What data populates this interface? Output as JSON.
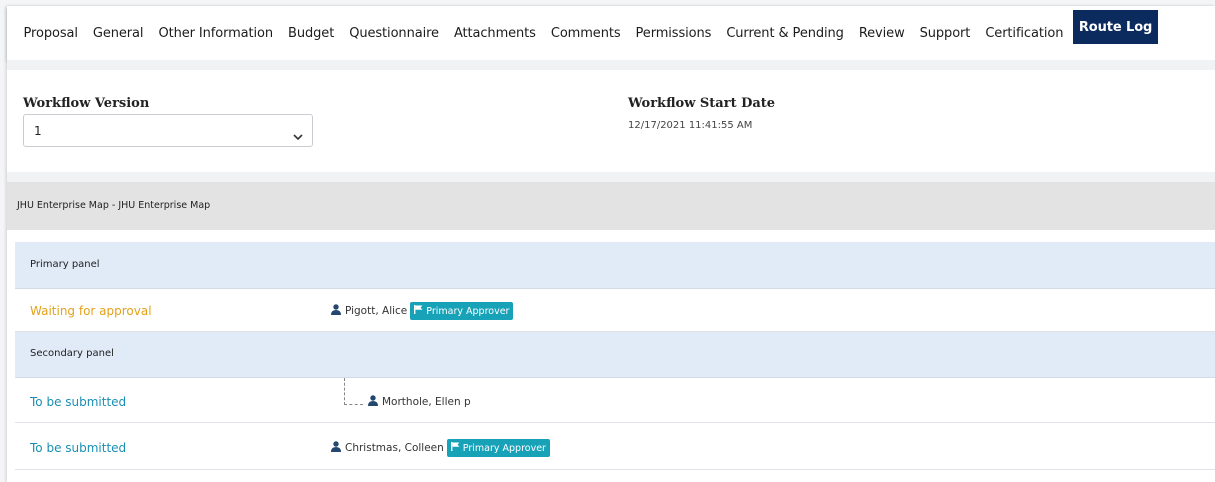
{
  "tabs": [
    {
      "label": "Proposal",
      "active": false
    },
    {
      "label": "General",
      "active": false
    },
    {
      "label": "Other Information",
      "active": false
    },
    {
      "label": "Budget",
      "active": false
    },
    {
      "label": "Questionnaire",
      "active": false
    },
    {
      "label": "Attachments",
      "active": false
    },
    {
      "label": "Comments",
      "active": false
    },
    {
      "label": "Permissions",
      "active": false
    },
    {
      "label": "Current & Pending",
      "active": false
    },
    {
      "label": "Review",
      "active": false
    },
    {
      "label": "Support",
      "active": false
    },
    {
      "label": "Certification",
      "active": false
    },
    {
      "label": "Route Log",
      "active": true
    }
  ],
  "workflow": {
    "version_label": "Workflow Version",
    "version_value": "1",
    "start_date_label": "Workflow Start Date",
    "start_date_value": "12/17/2021 11:41:55 AM"
  },
  "map_header": "JHU Enterprise Map - JHU Enterprise Map",
  "panels": [
    {
      "title": "Primary panel",
      "steps": [
        {
          "status": "Waiting for approval",
          "person": "Pigott, Alice",
          "badge": "Primary Approver"
        }
      ]
    },
    {
      "title": "Secondary panel",
      "steps": [
        {
          "status": "To be submitted",
          "person": "Morthole, Ellen p",
          "badge": ""
        },
        {
          "status": "To be submitted",
          "person": "Christmas, Colleen",
          "badge": "Primary Approver"
        }
      ]
    }
  ],
  "colors": {
    "active_tab": "#0b2a5e",
    "waiting": "#e3a21a",
    "submit": "#1a8fb3",
    "badge": "#17a2b8",
    "panel_bg": "#e1eaf7"
  },
  "icons": {
    "user": "user-icon",
    "flag": "flag-icon",
    "dropdown": "chevron-down-icon"
  }
}
